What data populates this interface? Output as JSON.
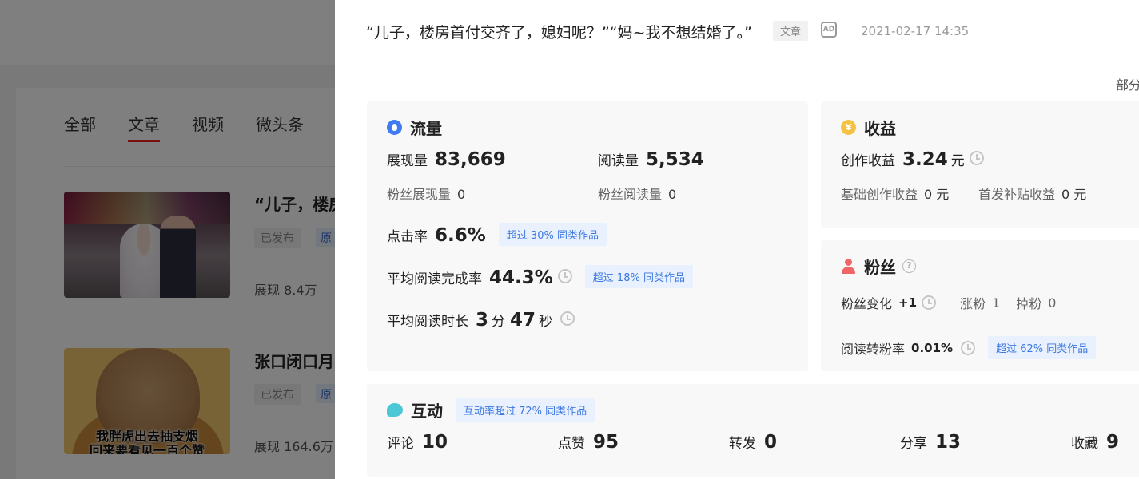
{
  "background": {
    "tabs": [
      "全部",
      "文章",
      "视频",
      "微头条"
    ],
    "active_tab": "文章",
    "articles": [
      {
        "title": "“儿子，楼房",
        "status": "已发布",
        "original": "原",
        "views": "展现 8.4万"
      },
      {
        "title": "张口闭口月",
        "status": "已发布",
        "original": "原",
        "views": "展现 164.6万",
        "thumb_caption": [
          "我胖虎出去抽支烟",
          "回来要看见一百个赞"
        ]
      }
    ]
  },
  "drawer": {
    "article_title": "“儿子，楼房首付交齐了，媳妇呢？”“妈~我不想结婚了。”",
    "type_tag": "文章",
    "ad_icon": "AD",
    "publish_time": "2021-02-17 14:35",
    "partial_text": "部分"
  },
  "traffic": {
    "icon": "drop-icon",
    "title": "流量",
    "impressions_label": "展现量",
    "impressions_value": "83,669",
    "reads_label": "阅读量",
    "reads_value": "5,534",
    "fan_impressions_label": "粉丝展现量",
    "fan_impressions_value": "0",
    "fan_reads_label": "粉丝阅读量",
    "fan_reads_value": "0",
    "ctr_label": "点击率",
    "ctr_value": "6.6%",
    "ctr_badge": "超过 30% 同类作品",
    "completion_label": "平均阅读完成率",
    "completion_value": "44.3%",
    "completion_badge": "超过 18% 同类作品",
    "duration_label": "平均阅读时长",
    "duration_min": "3",
    "duration_min_unit": "分",
    "duration_sec": "47",
    "duration_sec_unit": "秒"
  },
  "income": {
    "icon": "coin-icon",
    "title": "收益",
    "creation_label": "创作收益",
    "creation_value": "3.24",
    "creation_unit": "元",
    "base_label": "基础创作收益",
    "base_value": "0 元",
    "first_label": "首发补贴收益",
    "first_value": "0 元"
  },
  "fans": {
    "icon": "user-icon",
    "title": "粉丝",
    "change_label": "粉丝变化",
    "change_value": "+1",
    "gain_label": "涨粉",
    "gain_value": "1",
    "loss_label": "掉粉",
    "loss_value": "0",
    "conversion_label": "阅读转粉率",
    "conversion_value": "0.01%",
    "conversion_badge": "超过 62% 同类作品"
  },
  "interaction": {
    "icon": "chat-icon",
    "title": "互动",
    "badge": "互动率超过 72% 同类作品",
    "items": [
      {
        "label": "评论",
        "value": "10"
      },
      {
        "label": "点赞",
        "value": "95"
      },
      {
        "label": "转发",
        "value": "0"
      },
      {
        "label": "分享",
        "value": "13"
      },
      {
        "label": "收藏",
        "value": "9"
      }
    ]
  },
  "colors": {
    "accent_blue": "#3d78e0",
    "badge_bg": "#e9f1fe",
    "tab_underline": "#e22222",
    "coin": "#f5c242",
    "fans_red": "#f06565",
    "chat_teal": "#4bc7d6"
  }
}
